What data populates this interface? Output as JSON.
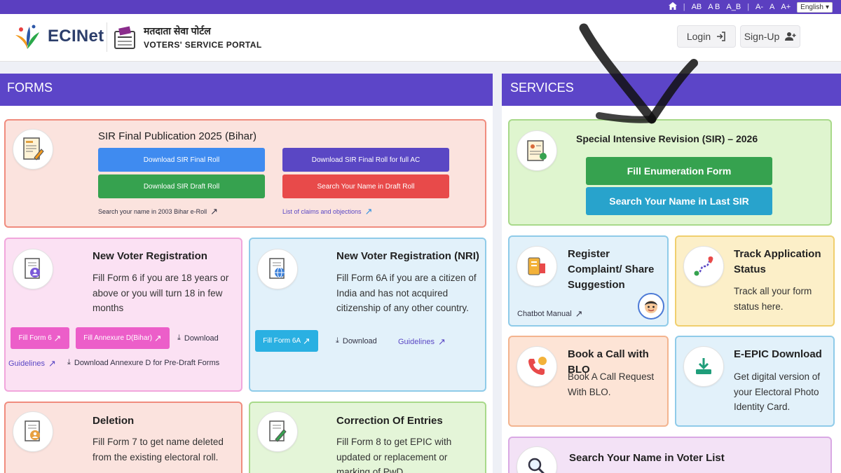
{
  "topbar": {
    "home_icon": "home-icon",
    "contrast_options": [
      "AB",
      "A B",
      "A_B"
    ],
    "font_sizes": [
      "A-",
      "A",
      "A+"
    ],
    "language": "English"
  },
  "header": {
    "ecinet_logo": "ECINet",
    "portal_hindi": "मतदाता सेवा पोर्टल",
    "portal_english": "VOTERS' SERVICE PORTAL",
    "login_label": "Login",
    "signup_label": "Sign-Up"
  },
  "forms": {
    "heading": "FORMS",
    "sir_bihar": {
      "title": "SIR Final Publication 2025 (Bihar)",
      "btn_final_roll": "Download SIR Final Roll",
      "btn_final_roll_ac": "Download SIR Final Roll for full AC",
      "btn_draft_roll": "Download SIR Draft Roll",
      "btn_search_draft": "Search Your Name in Draft Roll",
      "link_2003": "Search your name in 2003 Bihar e-Roll",
      "link_claims": "List of claims and objections"
    },
    "new_voter": {
      "title": "New Voter Registration",
      "desc": "Fill Form 6 if you are 18 years or above or you will turn 18 in few months",
      "btn_form6": "Fill Form 6",
      "btn_annexure": "Fill Annexure D(Bihar)",
      "download": "Download",
      "guidelines": "Guidelines",
      "download_annexure": "Download Annexure D for Pre-Draft Forms"
    },
    "nri": {
      "title": "New Voter Registration (NRI)",
      "desc": "Fill Form 6A if you are a citizen of India and has not acquired citizenship of any other country.",
      "btn_form6a": "Fill Form 6A",
      "download": "Download",
      "guidelines": "Guidelines"
    },
    "deletion": {
      "title": "Deletion",
      "desc": "Fill Form 7 to get name deleted from the existing electoral roll."
    },
    "correction": {
      "title": "Correction Of Entries",
      "desc": "Fill Form 8 to get EPIC with updated or replacement or marking of PwD."
    }
  },
  "services": {
    "heading": "SERVICES",
    "sir_2026": {
      "title": "Special Intensive Revision (SIR) – 2026",
      "btn_fill": "Fill Enumeration Form",
      "btn_search": "Search Your Name in Last SIR"
    },
    "complaint": {
      "title": "Register Complaint/ Share Suggestion",
      "chatbot": "Chatbot Manual"
    },
    "track": {
      "title": "Track Application Status",
      "desc": "Track all your form status here."
    },
    "blo": {
      "title": "Book a Call with BLO",
      "desc": "Book A Call Request With BLO."
    },
    "epic": {
      "title": "E-EPIC Download",
      "desc": "Get digital version of your Electoral Photo Identity Card."
    },
    "search_voter": {
      "title": "Search Your Name in Voter List"
    }
  }
}
